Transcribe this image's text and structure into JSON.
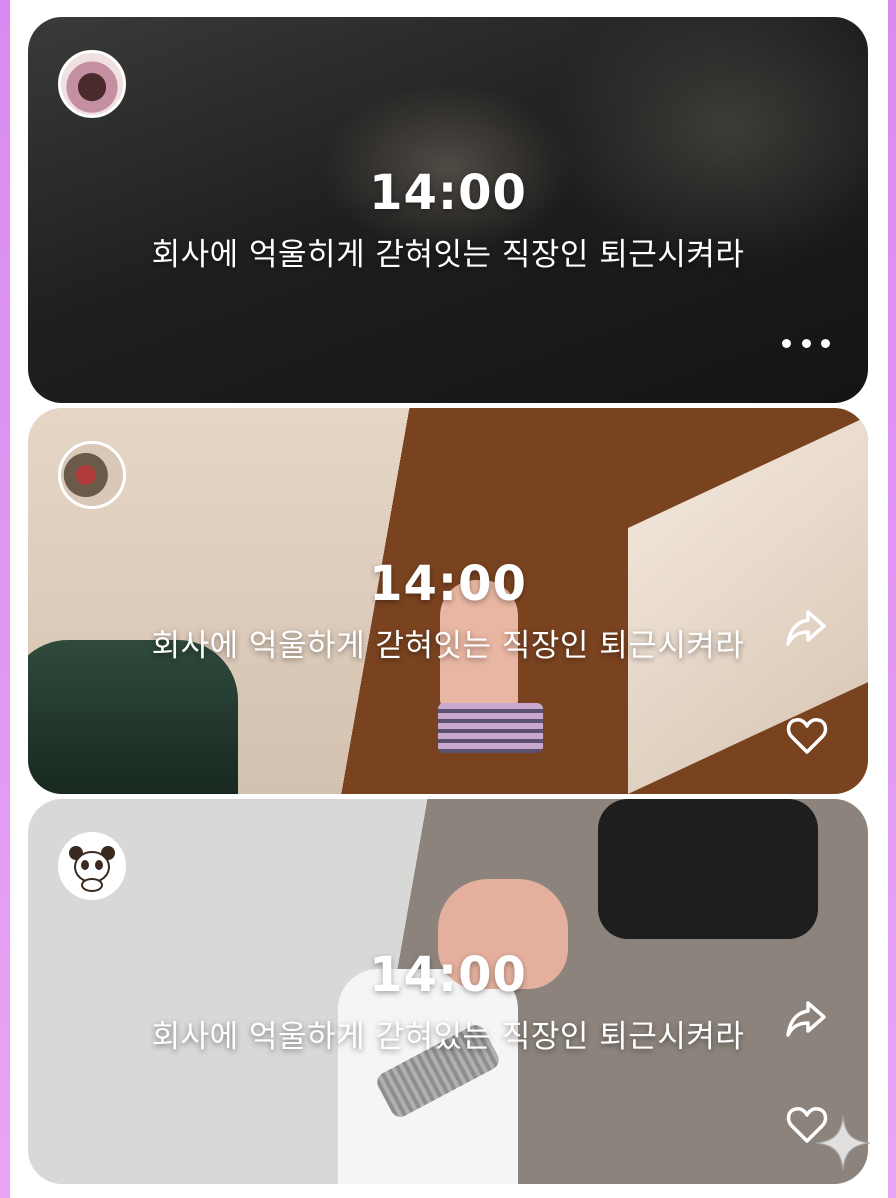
{
  "feed": {
    "posts": [
      {
        "time": "14:00",
        "caption": "회사에 억울히게 갇혀잇는 직장인 퇴근시켜라",
        "more_icon": "more-horizontal-icon"
      },
      {
        "time": "14:00",
        "caption": "회사에 억울하게 갇혀잇는 직장인 퇴근시켜라",
        "share_icon": "share-icon",
        "like_icon": "heart-icon"
      },
      {
        "time": "14:00",
        "caption": "회사에 억울하게 갇혀있는 직장인 퇴근시켜라",
        "share_icon": "share-icon",
        "like_icon": "heart-icon"
      }
    ]
  },
  "colors": {
    "accent_edge": "#d98af0",
    "text": "#ffffff"
  }
}
